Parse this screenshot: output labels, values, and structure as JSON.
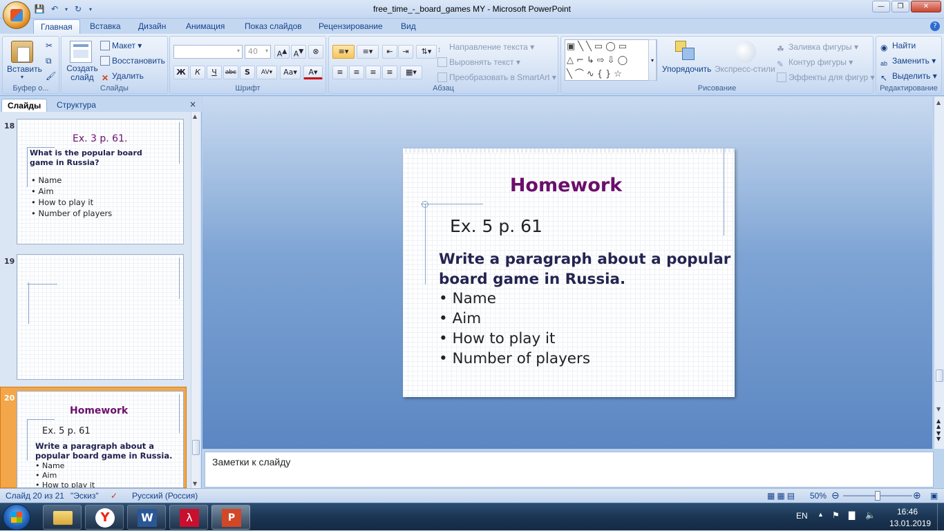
{
  "window": {
    "title": "free_time_-_board_games MY - Microsoft PowerPoint"
  },
  "ribbon_tabs": [
    "Главная",
    "Вставка",
    "Дизайн",
    "Анимация",
    "Показ слайдов",
    "Рецензирование",
    "Вид"
  ],
  "ribbon": {
    "clipboard": {
      "paste": "Вставить",
      "group": "Буфер о..."
    },
    "slides": {
      "new_slide": "Создать слайд",
      "layout": "Макет",
      "reset": "Восстановить",
      "delete": "Удалить",
      "group": "Слайды"
    },
    "font": {
      "size": "40",
      "group": "Шрифт"
    },
    "paragraph": {
      "text_direction": "Направление текста",
      "align_text": "Выровнять текст",
      "smartart": "Преобразовать в SmartArt",
      "group": "Абзац"
    },
    "drawing": {
      "arrange": "Упорядочить",
      "quick_styles": "Экспресс-стили",
      "fill": "Заливка фигуры",
      "outline": "Контур фигуры",
      "effects": "Эффекты для фигур",
      "group": "Рисование"
    },
    "editing": {
      "find": "Найти",
      "replace": "Заменить",
      "select": "Выделить",
      "group": "Редактирование"
    }
  },
  "pane": {
    "tab_slides": "Слайды",
    "tab_outline": "Структура",
    "close": "×"
  },
  "thumbnails": [
    {
      "num": "18",
      "title": "Ex. 3 p. 61.",
      "question": "What is the popular board game in Russia?",
      "bullets": [
        "• Name",
        "• Aim",
        "• How to play it",
        "• Number of players"
      ]
    },
    {
      "num": "19"
    },
    {
      "num": "20",
      "title": "Homework",
      "subtitle": "Ex. 5 p. 61",
      "question": "Write a paragraph about a popular board game in Russia.",
      "bullets": [
        "• Name",
        "• Aim",
        "• How to play it"
      ]
    }
  ],
  "slide": {
    "title": "Homework",
    "subtitle": "Ex. 5 p. 61",
    "body": "Write a paragraph about a popular board game in Russia.",
    "bullets": [
      "• Name",
      "• Aim",
      "• How to play it",
      "• Number of players"
    ],
    "title_color": "#6b0f6b"
  },
  "notes_placeholder": "Заметки к слайду",
  "status": {
    "slide_info": "Слайд 20 из 21",
    "theme": "\"Эскиз\"",
    "language": "Русский (Россия)",
    "zoom": "50%",
    "zoom_level": 0.5
  },
  "tray": {
    "lang": "EN",
    "time": "16:46",
    "date": "13.01.2019"
  }
}
